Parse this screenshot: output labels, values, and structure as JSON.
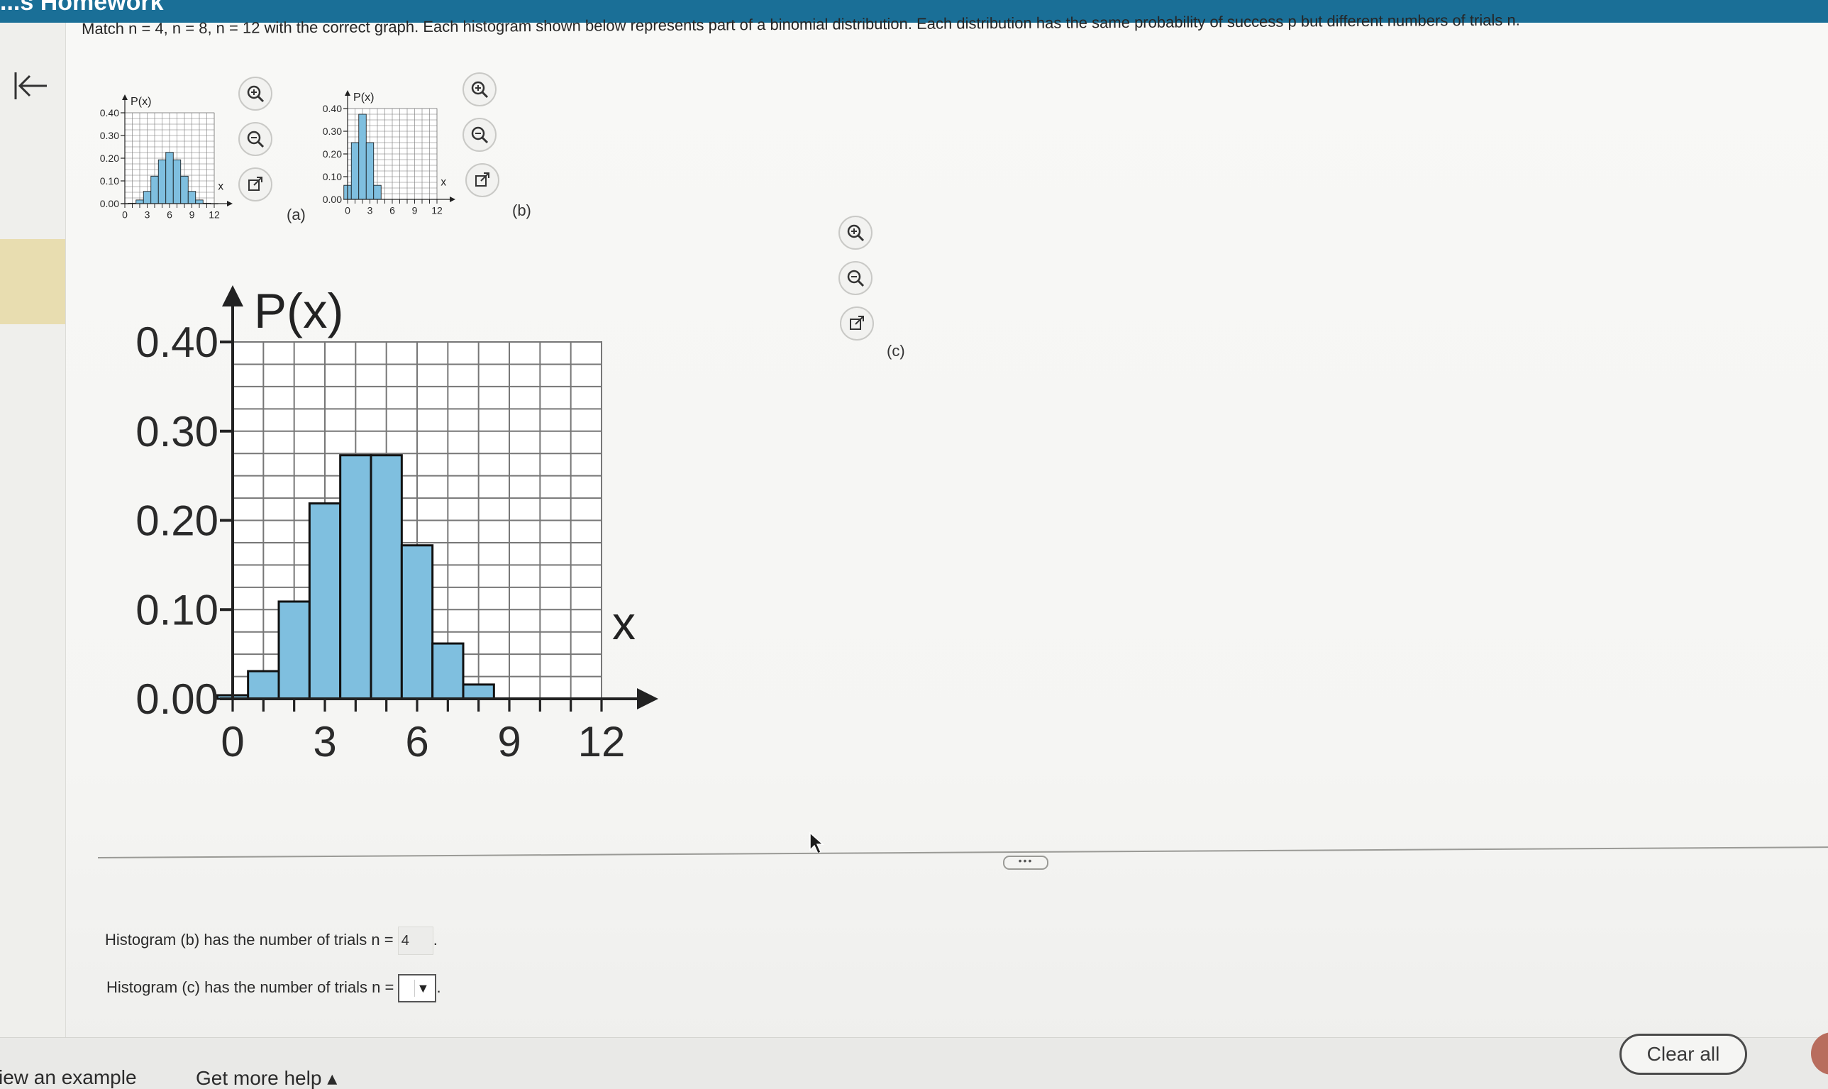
{
  "header": {
    "title": "...s Homework"
  },
  "question": {
    "text": "Match n = 4, n = 8, n = 12 with the correct graph. Each histogram shown below represents part of a binomial distribution. Each distribution has the same probability of success p but different numbers of trials n."
  },
  "icons": {
    "back": "back-arrow-icon",
    "zoom_in": "zoom-in-icon",
    "zoom_out": "zoom-out-icon",
    "popout": "popout-icon"
  },
  "graphs": [
    {
      "label": "(a)"
    },
    {
      "label": "(b)"
    },
    {
      "label": "(c)"
    }
  ],
  "chart_data": [
    {
      "type": "bar",
      "id": "a",
      "ylabel": "P(x)",
      "xlabel": "x",
      "x_ticks": [
        "0",
        "3",
        "6",
        "9",
        "12"
      ],
      "y_ticks": [
        "0.00",
        "0.10",
        "0.20",
        "0.30",
        "0.40"
      ],
      "ylim": [
        0,
        0.4
      ],
      "xlim": [
        0,
        12
      ],
      "categories": [
        0,
        1,
        2,
        3,
        4,
        5,
        6,
        7,
        8,
        9,
        10,
        11,
        12
      ],
      "values": [
        0.0,
        0.002,
        0.016,
        0.054,
        0.121,
        0.193,
        0.226,
        0.193,
        0.121,
        0.054,
        0.016,
        0.002,
        0.0
      ]
    },
    {
      "type": "bar",
      "id": "b",
      "ylabel": "P(x)",
      "xlabel": "x",
      "x_ticks": [
        "0",
        "3",
        "6",
        "9",
        "12"
      ],
      "y_ticks": [
        "0.00",
        "0.10",
        "0.20",
        "0.30",
        "0.40"
      ],
      "ylim": [
        0,
        0.4
      ],
      "xlim": [
        0,
        12
      ],
      "categories": [
        0,
        1,
        2,
        3,
        4
      ],
      "values": [
        0.062,
        0.25,
        0.375,
        0.25,
        0.062
      ]
    },
    {
      "type": "bar",
      "id": "c",
      "ylabel": "P(x)",
      "xlabel": "x",
      "x_ticks": [
        "0",
        "3",
        "6",
        "9",
        "12"
      ],
      "y_ticks": [
        "0.00",
        "0.10",
        "0.20",
        "0.30",
        "0.40"
      ],
      "ylim": [
        0,
        0.4
      ],
      "xlim": [
        0,
        12
      ],
      "categories": [
        0,
        1,
        2,
        3,
        4,
        5,
        6,
        7,
        8
      ],
      "values": [
        0.004,
        0.031,
        0.109,
        0.219,
        0.273,
        0.273,
        0.172,
        0.062,
        0.016
      ]
    }
  ],
  "answers": {
    "b_prefix": "Histogram (b) has the number of trials n =",
    "b_value": "4",
    "b_suffix": ".",
    "c_prefix": "Histogram (c) has the number of trials n =",
    "c_selected": "",
    "c_suffix": "."
  },
  "footer": {
    "view_example": "iew an example",
    "more_help": "Get more help ▴",
    "clear_all": "Clear all"
  },
  "more_handle": "•••"
}
